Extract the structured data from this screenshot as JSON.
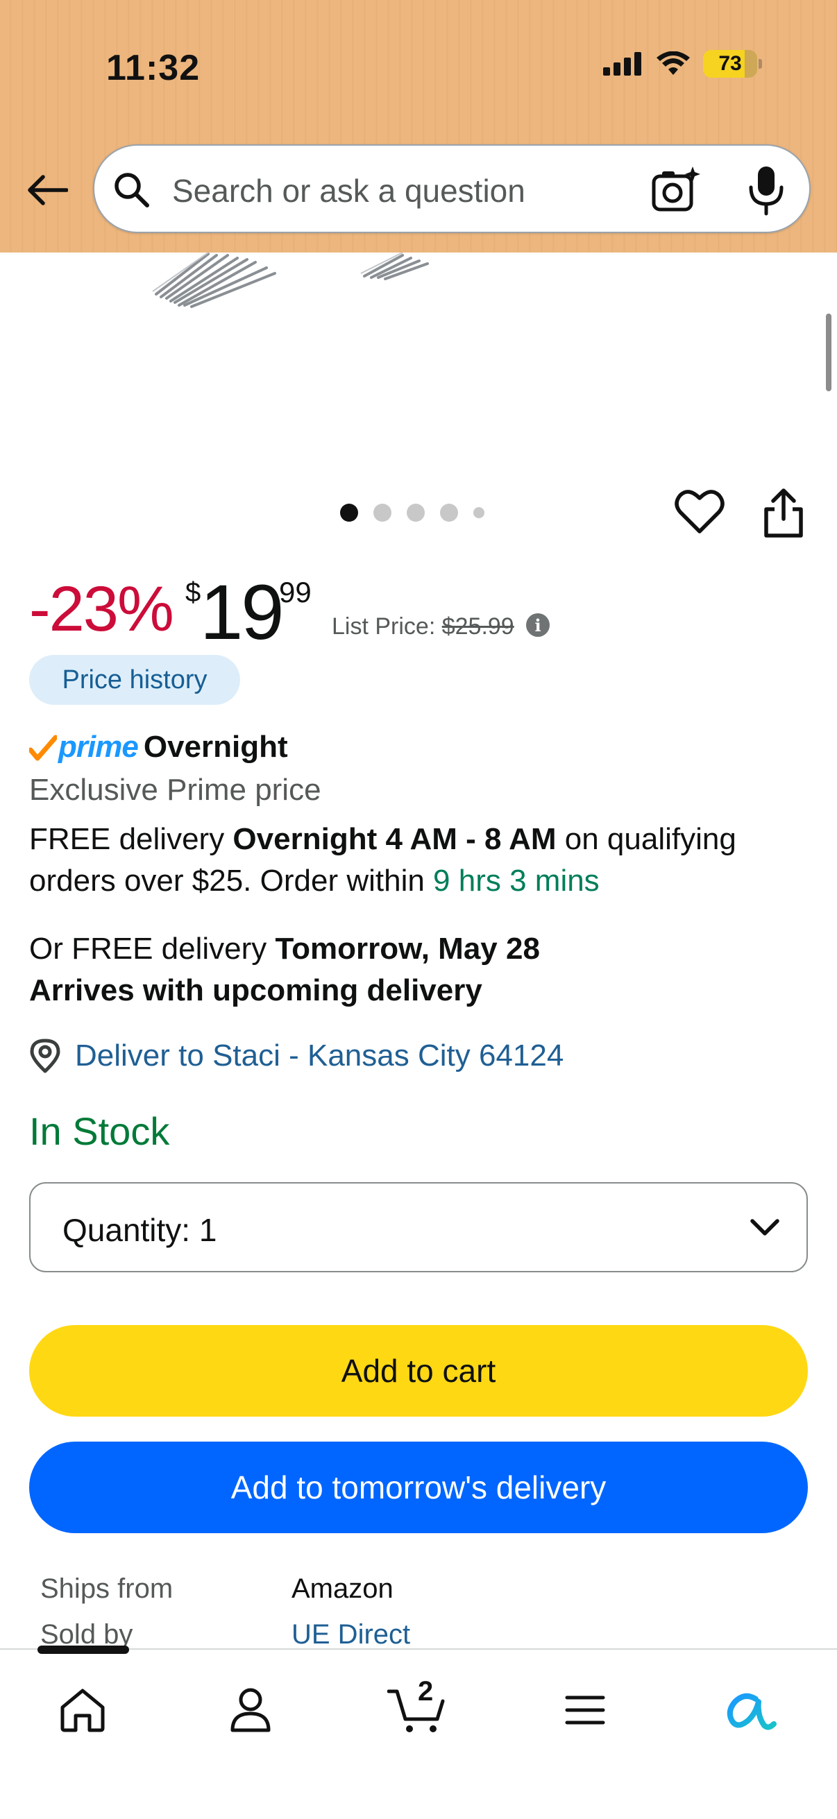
{
  "status_bar": {
    "time": "11:32",
    "battery": "73"
  },
  "search": {
    "placeholder": "Search or ask a question"
  },
  "icons": {
    "back": "back-arrow-icon",
    "search": "search-icon",
    "camera": "camera-icon",
    "mic": "microphone-icon",
    "heart": "heart-icon",
    "share": "share-icon",
    "info": "info-icon",
    "location": "location-pin-icon",
    "chevron": "chevron-down-icon",
    "home": "home-icon",
    "account": "account-icon",
    "cart": "cart-icon",
    "menu": "menu-icon",
    "assistant": "rufus-icon"
  },
  "gallery": {
    "image_count": 5,
    "active_index": 0
  },
  "price": {
    "discount": "-23%",
    "currency": "$",
    "whole": "19",
    "cents": "99",
    "list_price_label": "List Price:",
    "list_price_value": "$25.99",
    "history_label": "Price history"
  },
  "prime": {
    "brand": "prime",
    "overnight": "Overnight",
    "exclusive": "Exclusive Prime price"
  },
  "delivery": {
    "line1_prefix": "FREE delivery ",
    "line1_bold": "Overnight 4 AM - 8 AM",
    "line1_suffix": " on qualifying orders over $25. Order within ",
    "countdown": "9 hrs 3 mins",
    "line2_prefix": "Or FREE delivery ",
    "line2_bold": "Tomorrow, May 28",
    "line2_arrives": "Arrives with upcoming delivery",
    "location": "Deliver to Staci - Kansas City 64124"
  },
  "stock": "In Stock",
  "quantity": {
    "label": "Quantity: 1"
  },
  "buttons": {
    "add_to_cart": "Add to cart",
    "add_to_tomorrow": "Add to tomorrow's delivery"
  },
  "seller": {
    "ships_from_label": "Ships from",
    "ships_from_value": "Amazon",
    "sold_by_label": "Sold by",
    "sold_by_value": "UE Direct"
  },
  "bottom_nav": {
    "cart_count": "2"
  },
  "colors": {
    "header_bg": "#ecb67e",
    "discount": "#cc0c39",
    "prime_blue": "#1a98ff",
    "in_stock": "#007a38",
    "countdown": "#007e5a",
    "link": "#1f5f94",
    "cart_button": "#ffd814",
    "tomorrow_button": "#0066ff"
  }
}
